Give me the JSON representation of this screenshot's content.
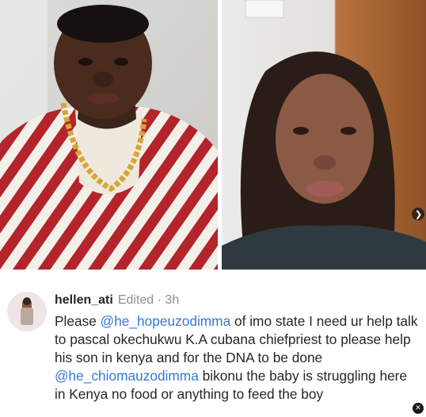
{
  "post": {
    "photos": [
      {
        "description_icon": "man-portrait-photo"
      },
      {
        "description_icon": "woman-portrait-photo"
      }
    ],
    "carousel_next_icon": "chevron-right-icon",
    "carousel_next_glyph": "❯"
  },
  "comment": {
    "username": "hellen_ati",
    "edited_label": "Edited",
    "separator": "·",
    "timestamp": "3h",
    "text_parts": {
      "p1": "Please ",
      "mention1": "@he_hopeuzodimma",
      "p2": " of imo state I need ur help talk to pascal okechukwu K.A cubana chiefpriest to please help his son in kenya and for the DNA to be done ",
      "mention2": "@he_chiomauzodimma",
      "p3": " bikonu the baby is struggling here in Kenya no food or anything to feed the boy"
    },
    "more_glyph": "✕",
    "mention_color": "#3777d3"
  }
}
